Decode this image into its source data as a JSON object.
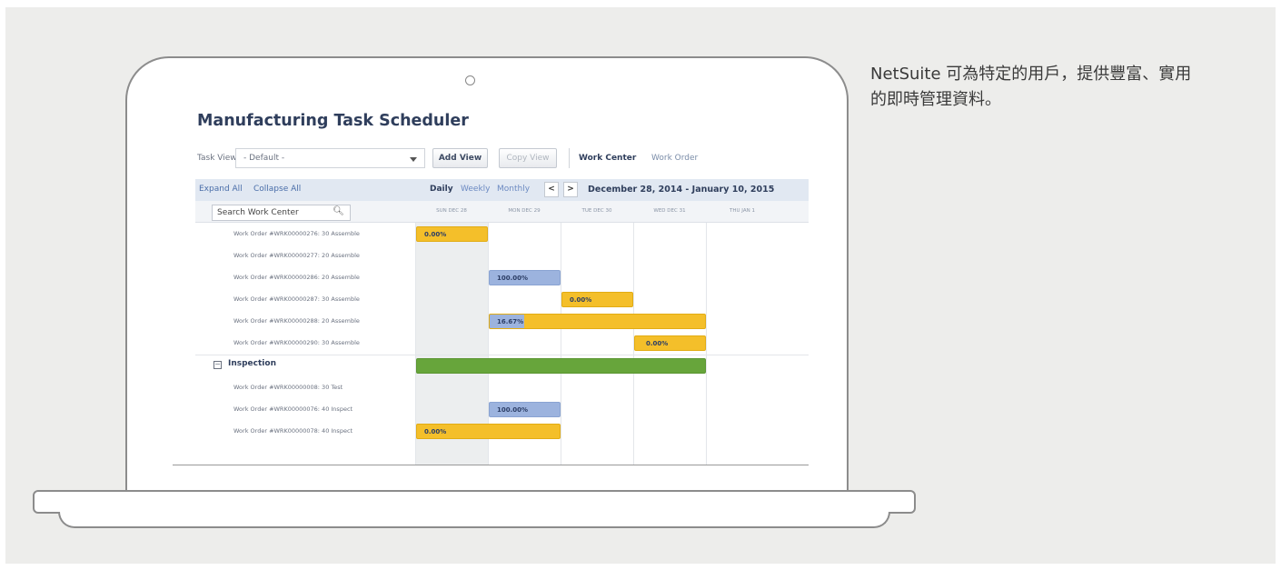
{
  "caption": "NetSuite 可為特定的用戶，提供豐富、實用的即時管理資料。",
  "app": {
    "title": "Manufacturing Task Scheduler",
    "toolbar": {
      "task_view_label": "Task View",
      "task_view_value": "- Default -",
      "add_view": "Add View",
      "copy_view": "Copy View",
      "work_center": "Work Center",
      "work_order": "Work Order"
    },
    "grid": {
      "expand_all": "Expand All",
      "collapse_all": "Collapse All",
      "views": [
        "Daily",
        "Weekly",
        "Monthly"
      ],
      "prev": "<",
      "next": ">",
      "date_range": "December 28, 2014 - January 10, 2015",
      "search_placeholder": "Search Work Center",
      "days": [
        "SUN DEC 28",
        "MON DEC 29",
        "TUE DEC 30",
        "WED DEC 31",
        "THU JAN 1"
      ],
      "rows": [
        {
          "label": "Work Order #WRK00000276: 30 Assemble"
        },
        {
          "label": "Work Order #WRK00000277: 20 Assemble"
        },
        {
          "label": "Work Order #WRK00000286: 20 Assemble"
        },
        {
          "label": "Work Order #WRK00000287: 30 Assemble"
        },
        {
          "label": "Work Order #WRK00000288: 20 Assemble"
        },
        {
          "label": "Work Order #WRK00000290: 30 Assemble"
        }
      ],
      "group": {
        "toggle": "−",
        "label": "Inspection"
      },
      "group_rows": [
        {
          "label": "Work Order #WRK00000008: 30 Test"
        },
        {
          "label": "Work Order #WRK00000076: 40 Inspect"
        },
        {
          "label": "Work Order #WRK00000078: 40 Inspect"
        }
      ],
      "bars": {
        "row1": "0.00%",
        "row3": "100.00%",
        "row4": "0.00%",
        "row5": "16.67%",
        "row6": "0.00%",
        "group_row2": "100.00%",
        "group_row3": "0.00%"
      }
    }
  },
  "colors": {
    "task_in_progress": "#f4bf2a",
    "task_complete": "#9cb3de",
    "group_summary": "#67a53b",
    "title": "#2f3e5c"
  }
}
